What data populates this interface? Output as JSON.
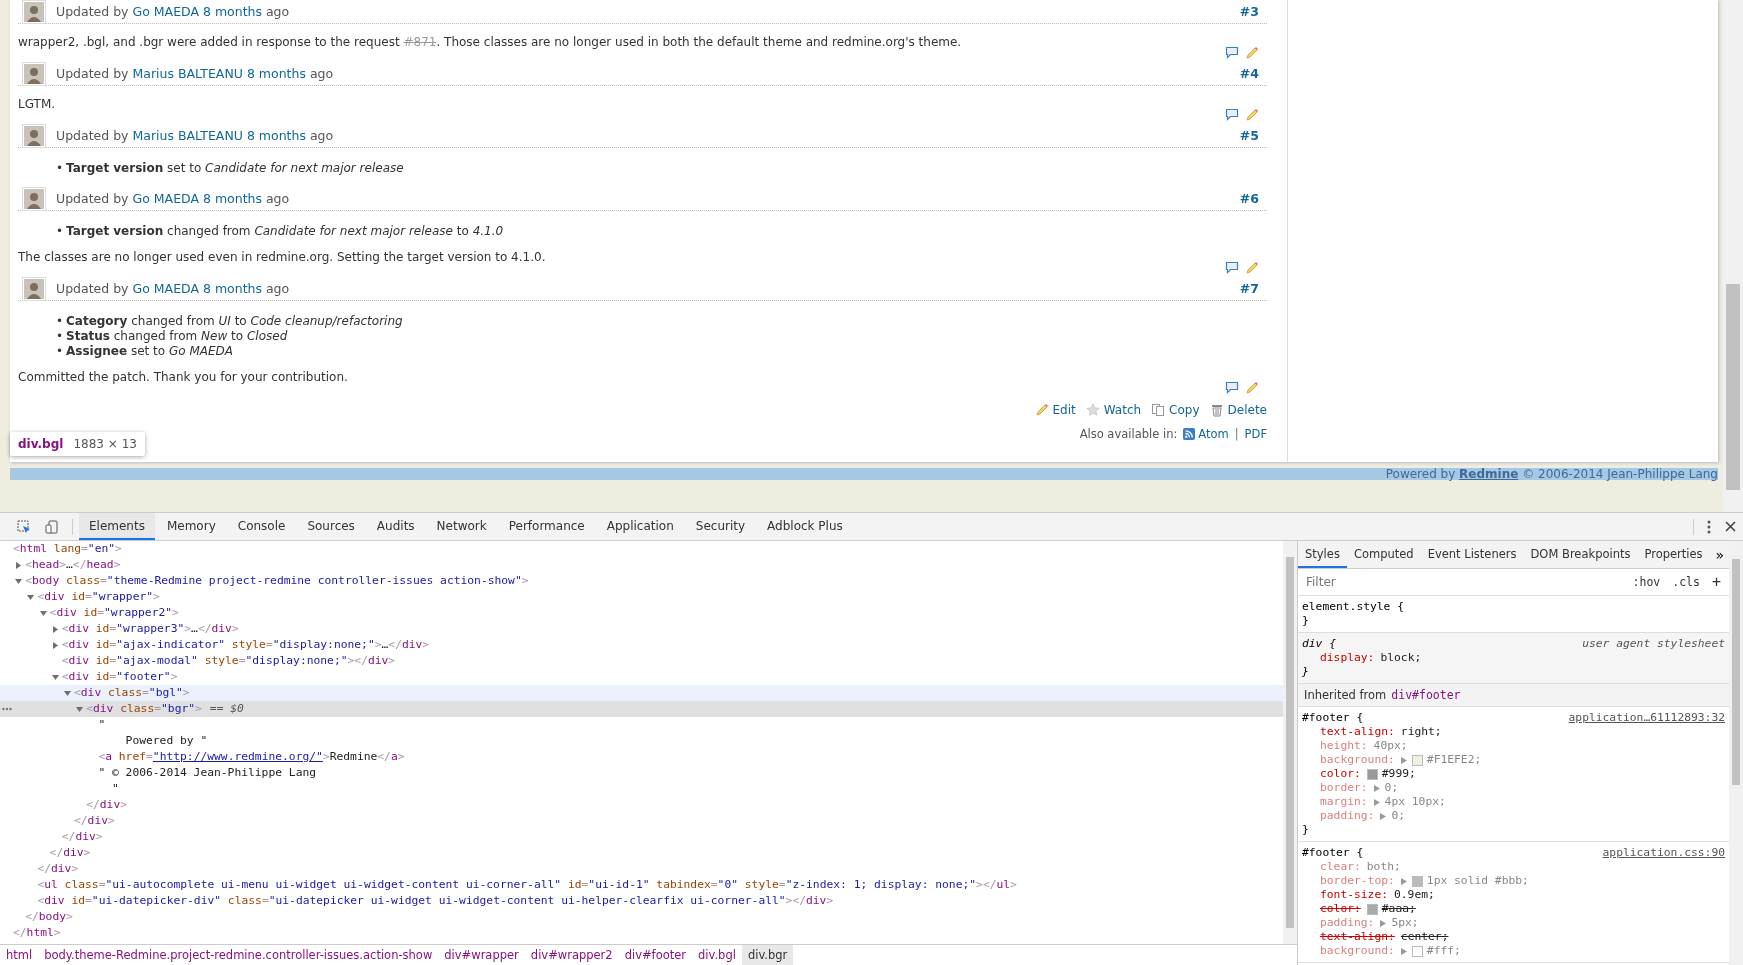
{
  "page": {
    "journal": [
      {
        "prefix": "Updated by",
        "author": "Go MAEDA",
        "time": "8 months",
        "suffix": "ago",
        "number": "#3",
        "notes": [
          {
            "kind": "text",
            "text": "wrapper2, .bgl, and .bgr were added in response to the request "
          },
          {
            "kind": "closed-issue",
            "text": "#871"
          },
          {
            "kind": "text",
            "text": ". Those classes are no longer used in both the default theme and redmine.org's theme."
          }
        ]
      },
      {
        "prefix": "Updated by",
        "author": "Marius BALTEANU",
        "time": "8 months",
        "suffix": "ago",
        "number": "#4",
        "notes": [
          {
            "kind": "text",
            "text": "LGTM."
          }
        ]
      },
      {
        "prefix": "Updated by",
        "author": "Marius BALTEANU",
        "time": "8 months",
        "suffix": "ago",
        "number": "#5",
        "details": [
          {
            "marker": "•",
            "text": "**Target version** set to *Candidate for next major release*"
          }
        ]
      },
      {
        "prefix": "Updated by",
        "author": "Go MAEDA",
        "time": "8 months",
        "suffix": "ago",
        "number": "#6",
        "details": [
          {
            "marker": "•",
            "text": "**Target version** changed from *Candidate for next major release* to *4.1.0*"
          }
        ],
        "notes": [
          {
            "kind": "text",
            "text": "The classes are no longer used even in redmine.org. Setting the target version to 4.1.0."
          }
        ]
      },
      {
        "prefix": "Updated by",
        "author": "Go MAEDA",
        "time": "8 months",
        "suffix": "ago",
        "number": "#7",
        "details": [
          {
            "marker": "•",
            "text": "**Category** changed from *UI* to *Code cleanup/refactoring*"
          },
          {
            "marker": "•",
            "text": "**Status** changed from *New* to *Closed*"
          },
          {
            "marker": "•",
            "text": "**Assignee** set to *Go MAEDA*"
          }
        ],
        "notes": [
          {
            "kind": "text",
            "text": "Committed the patch. Thank you for your contribution."
          }
        ]
      }
    ],
    "actions": [
      {
        "kind": "edit",
        "label": "Edit"
      },
      {
        "kind": "watch",
        "label": "Watch"
      },
      {
        "kind": "copy",
        "label": "Copy"
      },
      {
        "kind": "delete",
        "label": "Delete"
      }
    ],
    "other_formats": {
      "label": "Also available in:",
      "links": [
        {
          "kind": "feed",
          "label": "Atom"
        },
        {
          "kind": "plain",
          "label": "PDF"
        }
      ],
      "separator": "|"
    },
    "footer": {
      "prefix": "Powered by",
      "link": "Redmine",
      "suffix": "© 2006-2014 Jean-Philippe Lang",
      "highlighted": true
    },
    "tooltip": {
      "selector": "div.bgl",
      "size": "1883 × 13"
    }
  },
  "devtools": {
    "tabs": [
      {
        "label": "Elements",
        "selected": true
      },
      {
        "label": "Memory",
        "selected": false
      },
      {
        "label": "Console",
        "selected": false
      },
      {
        "label": "Sources",
        "selected": false
      },
      {
        "label": "Audits",
        "selected": false
      },
      {
        "label": "Network",
        "selected": false
      },
      {
        "label": "Performance",
        "selected": false
      },
      {
        "label": "Application",
        "selected": false
      },
      {
        "label": "Security",
        "selected": false
      },
      {
        "label": "Adblock Plus",
        "selected": false
      }
    ],
    "dom": {
      "kind": "element",
      "line": "<html lang=\"en\">",
      "selected": false,
      "hovered": false,
      "close": "</html>",
      "children": [
        {
          "kind": "element",
          "line": "<head>…</head>",
          "expanded": false,
          "selected": false,
          "hovered": false
        },
        {
          "kind": "element",
          "line": "<body class=\"theme-Redmine project-redmine controller-issues action-show\">",
          "expanded": true,
          "selected": false,
          "hovered": false,
          "close": "</body>",
          "children": [
            {
              "kind": "element",
              "line": "<div id=\"wrapper\">",
              "expanded": true,
              "selected": false,
              "hovered": false,
              "close": "</div>",
              "children": [
                {
                  "kind": "element",
                  "line": "<div id=\"wrapper2\">",
                  "expanded": true,
                  "selected": false,
                  "hovered": false,
                  "close": "</div>",
                  "children": [
                    {
                      "kind": "element",
                      "line": "<div id=\"wrapper3\">…</div>",
                      "expanded": false,
                      "selected": false,
                      "hovered": false
                    },
                    {
                      "kind": "element",
                      "line": "<div id=\"ajax-indicator\" style=\"display:none;\">…</div>",
                      "expanded": false,
                      "selected": false,
                      "hovered": false
                    },
                    {
                      "kind": "element",
                      "line": "<div id=\"ajax-modal\" style=\"display:none;\"></div>",
                      "selected": false,
                      "hovered": false
                    },
                    {
                      "kind": "element",
                      "line": "<div id=\"footer\">",
                      "expanded": true,
                      "selected": false,
                      "hovered": false,
                      "close": "</div>",
                      "children": [
                        {
                          "kind": "element",
                          "line": "<div class=\"bgl\">",
                          "expanded": true,
                          "selected": false,
                          "hovered": true,
                          "close": "</div>",
                          "children": [
                            {
                              "kind": "element",
                              "line": "<div class=\"bgr\">",
                              "suffix": "== $0",
                              "expanded": true,
                              "selected": true,
                              "hovered": false,
                              "close": "</div>",
                              "children": [
                                {
                                  "kind": "text",
                                  "lines": [
                                    "\"",
                                    "    Powered by \""
                                  ]
                                },
                                {
                                  "kind": "element",
                                  "line": "<a href=\"http://www.redmine.org/\">Redmine</a>",
                                  "link": true,
                                  "selected": false,
                                  "hovered": false
                                },
                                {
                                  "kind": "text",
                                  "lines": [
                                    "\" © 2006-2014 Jean-Philippe Lang",
                                    "  \""
                                  ]
                                }
                              ]
                            }
                          ]
                        }
                      ]
                    }
                  ]
                }
              ]
            },
            {
              "kind": "element",
              "line": "<ul class=\"ui-autocomplete ui-menu ui-widget ui-widget-content ui-corner-all\" id=\"ui-id-1\" tabindex=\"0\" style=\"z-index: 1; display: none;\"></ul>",
              "selected": false,
              "hovered": false
            },
            {
              "kind": "element",
              "line": "<div id=\"ui-datepicker-div\" class=\"ui-datepicker ui-widget ui-widget-content ui-helper-clearfix ui-corner-all\"></div>",
              "selected": false,
              "hovered": false
            }
          ]
        }
      ]
    },
    "breadcrumb": [
      {
        "label": "html",
        "selected": false
      },
      {
        "label": "body.theme-Redmine.project-redmine.controller-issues.action-show",
        "selected": false
      },
      {
        "label": "div#wrapper",
        "selected": false
      },
      {
        "label": "div#wrapper2",
        "selected": false
      },
      {
        "label": "div#footer",
        "selected": false
      },
      {
        "label": "div.bgl",
        "selected": false
      },
      {
        "label": "div.bgr",
        "selected": true
      }
    ],
    "styles": {
      "tabs": [
        {
          "label": "Styles",
          "selected": true
        },
        {
          "label": "Computed",
          "selected": false
        },
        {
          "label": "Event Listeners",
          "selected": false
        },
        {
          "label": "DOM Breakpoints",
          "selected": false
        },
        {
          "label": "Properties",
          "selected": false
        }
      ],
      "more": "»",
      "filter": {
        "placeholder": "Filter"
      },
      "hov": ":hov",
      "cls": ".cls",
      "add": "+",
      "rules": [
        {
          "kind": "inline",
          "selector": "element.style {",
          "close": "}"
        },
        {
          "kind": "user-agent",
          "selector": "div {",
          "source": "user agent stylesheet",
          "close": "}",
          "properties": [
            {
              "name": "display:",
              "value": "block;",
              "dimmed": false,
              "overridden": false,
              "expandable": false
            }
          ]
        },
        {
          "kind": "inherited",
          "label": "Inherited from",
          "target": "div#footer"
        },
        {
          "kind": "rule",
          "selector": "#footer {",
          "source": "application…61112893:32",
          "close": "}",
          "properties": [
            {
              "name": "text-align:",
              "value": "right;",
              "dimmed": false,
              "overridden": false,
              "expandable": false
            },
            {
              "name": "height:",
              "value": "40px;",
              "dimmed": true,
              "overridden": false,
              "expandable": false
            },
            {
              "name": "background:",
              "value": "#F1EFE2;",
              "dimmed": true,
              "overridden": false,
              "expandable": true,
              "color": "#f1efe2"
            },
            {
              "name": "color:",
              "value": "#999;",
              "dimmed": false,
              "overridden": false,
              "expandable": false,
              "color": "#999999"
            },
            {
              "name": "border:",
              "value": "0;",
              "dimmed": true,
              "overridden": false,
              "expandable": true
            },
            {
              "name": "margin:",
              "value": "4px 10px;",
              "dimmed": true,
              "overridden": false,
              "expandable": true
            },
            {
              "name": "padding:",
              "value": "0;",
              "dimmed": true,
              "overridden": false,
              "expandable": true
            }
          ]
        },
        {
          "kind": "rule",
          "selector": "#footer {",
          "source": "application.css:90",
          "properties": [
            {
              "name": "clear:",
              "value": "both;",
              "dimmed": true,
              "overridden": false,
              "expandable": false
            },
            {
              "name": "border-top:",
              "value": "1px solid #bbb;",
              "dimmed": true,
              "overridden": false,
              "expandable": true,
              "color": "#bbbbbb"
            },
            {
              "name": "font-size:",
              "value": "0.9em;",
              "dimmed": false,
              "overridden": false,
              "expandable": false
            },
            {
              "name": "color:",
              "value": "#aaa;",
              "dimmed": false,
              "overridden": true,
              "expandable": false,
              "color": "#aaaaaa"
            },
            {
              "name": "padding:",
              "value": "5px;",
              "dimmed": true,
              "overridden": false,
              "expandable": true
            },
            {
              "name": "text-align:",
              "value": "center;",
              "dimmed": false,
              "overridden": true,
              "expandable": false
            },
            {
              "name": "background:",
              "value": "#fff;",
              "dimmed": true,
              "overridden": false,
              "expandable": true,
              "color": "#ffffff"
            }
          ]
        }
      ]
    }
  }
}
